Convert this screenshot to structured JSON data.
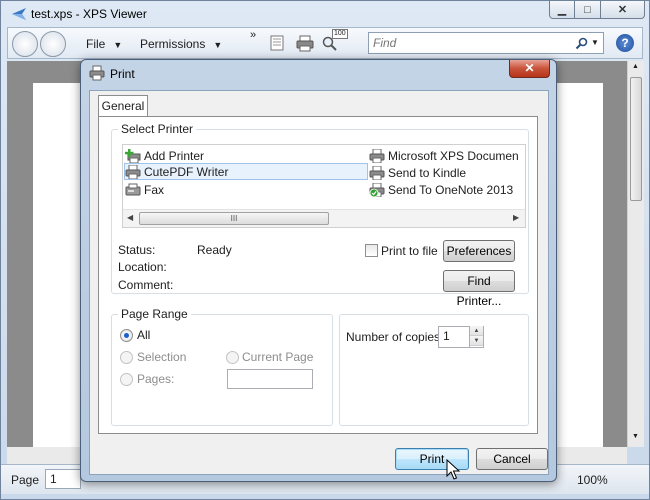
{
  "window": {
    "title": "test.xps - XPS Viewer",
    "caption": {
      "minimize": "▁",
      "maximize": "□",
      "close": "✕"
    }
  },
  "toolbar": {
    "file_label": "File",
    "permissions_label": "Permissions",
    "overflow": "»",
    "zoom_badge": "100",
    "find_placeholder": "Find",
    "help_label": "?"
  },
  "statusbar": {
    "page_label": "Page",
    "page_value": "1",
    "zoom": "100%"
  },
  "dialog": {
    "title": "Print",
    "close": "✕",
    "tab": "General",
    "select_printer": {
      "legend": "Select Printer",
      "printers": [
        {
          "name": "Add Printer",
          "icon": "add-printer-icon"
        },
        {
          "name": "CutePDF Writer",
          "icon": "printer-icon",
          "selected": true
        },
        {
          "name": "Fax",
          "icon": "fax-icon"
        },
        {
          "name": "Microsoft XPS Documen",
          "icon": "printer-icon"
        },
        {
          "name": "Send to Kindle",
          "icon": "printer-icon"
        },
        {
          "name": "Send To OneNote 2013",
          "icon": "default-printer-icon"
        }
      ],
      "scroll_grip": "III",
      "status_label": "Status:",
      "status_value": "Ready",
      "location_label": "Location:",
      "comment_label": "Comment:",
      "print_to_file": "Print to file",
      "preferences": "Preferences",
      "find_printer": "Find Printer..."
    },
    "page_range": {
      "legend": "Page Range",
      "all": "All",
      "selection": "Selection",
      "current_page": "Current Page",
      "pages": "Pages:"
    },
    "copies": {
      "label": "Number of copies:",
      "value": "1"
    },
    "buttons": {
      "print": "Print",
      "cancel": "Cancel"
    }
  }
}
